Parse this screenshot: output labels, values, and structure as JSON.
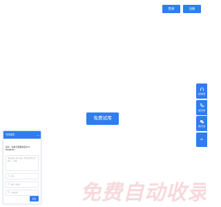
{
  "header": {
    "login_label": "登录",
    "register_label": "注册"
  },
  "main": {
    "cta_label": "免费试用"
  },
  "side_bar": {
    "items": [
      {
        "label": "在线客服",
        "icon": "headset-icon"
      },
      {
        "label": "电话咨询",
        "icon": "phone-icon"
      },
      {
        "label": "微信咨询",
        "icon": "wechat-icon"
      }
    ],
    "back_to_top_icon": "chevron-up-icon"
  },
  "chat": {
    "title": "在线留言",
    "close_symbol": "—",
    "greeting": "您好，请拨打客服电话0571-86398780",
    "message_placeholder": "请在此输入留言内容，我们会尽快与您联系。（必填）",
    "name_placeholder": "姓名",
    "phone_placeholder": "电话（必填）",
    "email_placeholder": "公司名称",
    "send_label": "提交"
  },
  "watermark": {
    "text": "免费自动收录"
  },
  "colors": {
    "accent": "#2f7df0",
    "watermark": "#f6d9dd"
  }
}
